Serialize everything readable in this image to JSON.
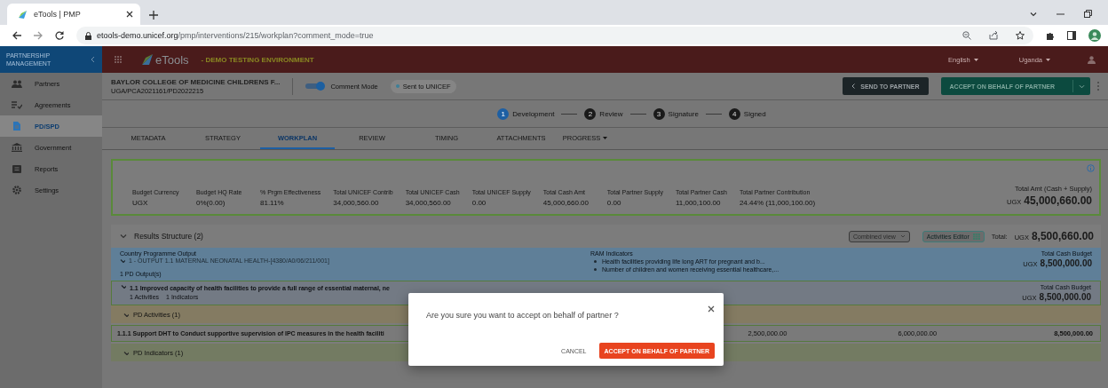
{
  "browser": {
    "tabs": [
      {
        "title": "eTools | PMP",
        "selected": true
      }
    ],
    "url_host": "etools-demo.unicef.org",
    "url_path": "/pmp/interventions/215/workplan?comment_mode=true"
  },
  "app_bar": {
    "section_title": "PARTNERSHIP MANAGEMENT",
    "logo": "eTools",
    "environment": "- DEMO TESTING ENVIRONMENT",
    "language": "English",
    "country": "Uganda"
  },
  "sidebar": {
    "items": [
      {
        "label": "Partners",
        "selected": false
      },
      {
        "label": "Agreements",
        "selected": false
      },
      {
        "label": "PD/SPD",
        "selected": true
      },
      {
        "label": "Government",
        "selected": false
      },
      {
        "label": "Reports",
        "selected": false
      },
      {
        "label": "Settings",
        "selected": false
      }
    ]
  },
  "intervention": {
    "title": "BAYLOR COLLEGE OF MEDICINE CHILDRENS F...",
    "reference": "UGA/PCA2021161/PD2022215",
    "comment_mode": {
      "label": "Comment Mode",
      "on": true
    },
    "status": "Sent to UNICEF",
    "actions": [
      {
        "label": "SEND TO PARTNER",
        "kind": "back"
      },
      {
        "label": "ACCEPT ON BEHALF OF PARTNER",
        "kind": "split"
      }
    ]
  },
  "stepper": [
    {
      "number": "1",
      "label": "Development",
      "active": true
    },
    {
      "number": "2",
      "label": "Review",
      "active": false
    },
    {
      "number": "3",
      "label": "Signature",
      "active": false
    },
    {
      "number": "4",
      "label": "Signed",
      "active": false
    }
  ],
  "tabs": [
    {
      "label": "METADATA",
      "selected": false,
      "kind": "tab"
    },
    {
      "label": "STRATEGY",
      "selected": false,
      "kind": "tab"
    },
    {
      "label": "WORKPLAN",
      "selected": true,
      "kind": "tab"
    },
    {
      "label": "REVIEW",
      "selected": false,
      "kind": "tab"
    },
    {
      "label": "TIMING",
      "selected": false,
      "kind": "tab"
    },
    {
      "label": "ATTACHMENTS",
      "selected": false,
      "kind": "tab"
    },
    {
      "label": "PROGRESS",
      "selected": false,
      "kind": "menu"
    }
  ],
  "summary": {
    "fields": [
      {
        "label": "Budget Currency",
        "value": "UGX"
      },
      {
        "label": "Budget HQ Rate",
        "value": "0%(0.00)"
      },
      {
        "label": "% Prgm Effectiveness",
        "value": "81.11%"
      },
      {
        "label": "Total UNICEF Contrib",
        "value": "34,000,560.00"
      },
      {
        "label": "Total UNICEF Cash",
        "value": "34,000,560.00"
      },
      {
        "label": "Total UNICEF Supply",
        "value": "0.00"
      },
      {
        "label": "Total Cash Amt",
        "value": "45,000,660.00"
      },
      {
        "label": "Total Partner Supply",
        "value": "0.00"
      },
      {
        "label": "Total Partner Cash",
        "value": "11,000,100.00"
      },
      {
        "label": "Total Partner Contribution",
        "value": "24.44% (11,000,100.00)"
      }
    ],
    "total": {
      "label": "Total Amt (Cash + Supply)",
      "currency": "UGX",
      "amount": "45,000,660.00"
    }
  },
  "results": {
    "title": "Results Structure (2)",
    "view": "Combined view",
    "editor": "Activities Editor",
    "total_label": "Total:",
    "total_currency": "UGX",
    "total_amount": "8,500,660.00",
    "output": {
      "label": "Country Programme Output",
      "title": "1 - OUTPUT 1.1 MATERNAL NEONATAL HEALTH-[4380/A0/06/211/001]",
      "count": "1 PD Output(s)",
      "indicators_label": "RAM Indicators",
      "indicators": [
        "Health facilities providing life long ART for pregnant and b...",
        "Number of children and women receiving essential healthcare,..."
      ],
      "budget_label": "Total Cash Budget",
      "currency": "UGX",
      "amount": "8,500,000.00"
    },
    "pd_output": {
      "title": "1.1 Improved capacity of health facilities to provide a full range of essential maternal, ne",
      "activities": "1 Activities",
      "indicators": "1 Indicators",
      "budget_label": "Total Cash Budget",
      "currency": "UGX",
      "amount": "8,500,000.00"
    },
    "activities_header": "PD Activities (1)",
    "activity": {
      "title": "1.1.1 Support DHT to Conduct supportive supervision of IPC measures in the health faciliti",
      "cells": [
        "2,500,000.00",
        "6,000,000.00",
        "8,500,000.00"
      ]
    },
    "indicators_header": "PD Indicators (1)"
  },
  "dialog": {
    "message": "Are you sure you want to accept on behalf of partner ?",
    "buttons": [
      {
        "label": "CANCEL",
        "kind": "text"
      },
      {
        "label": "ACCEPT ON BEHALF OF PARTNER",
        "kind": "primary"
      }
    ]
  }
}
